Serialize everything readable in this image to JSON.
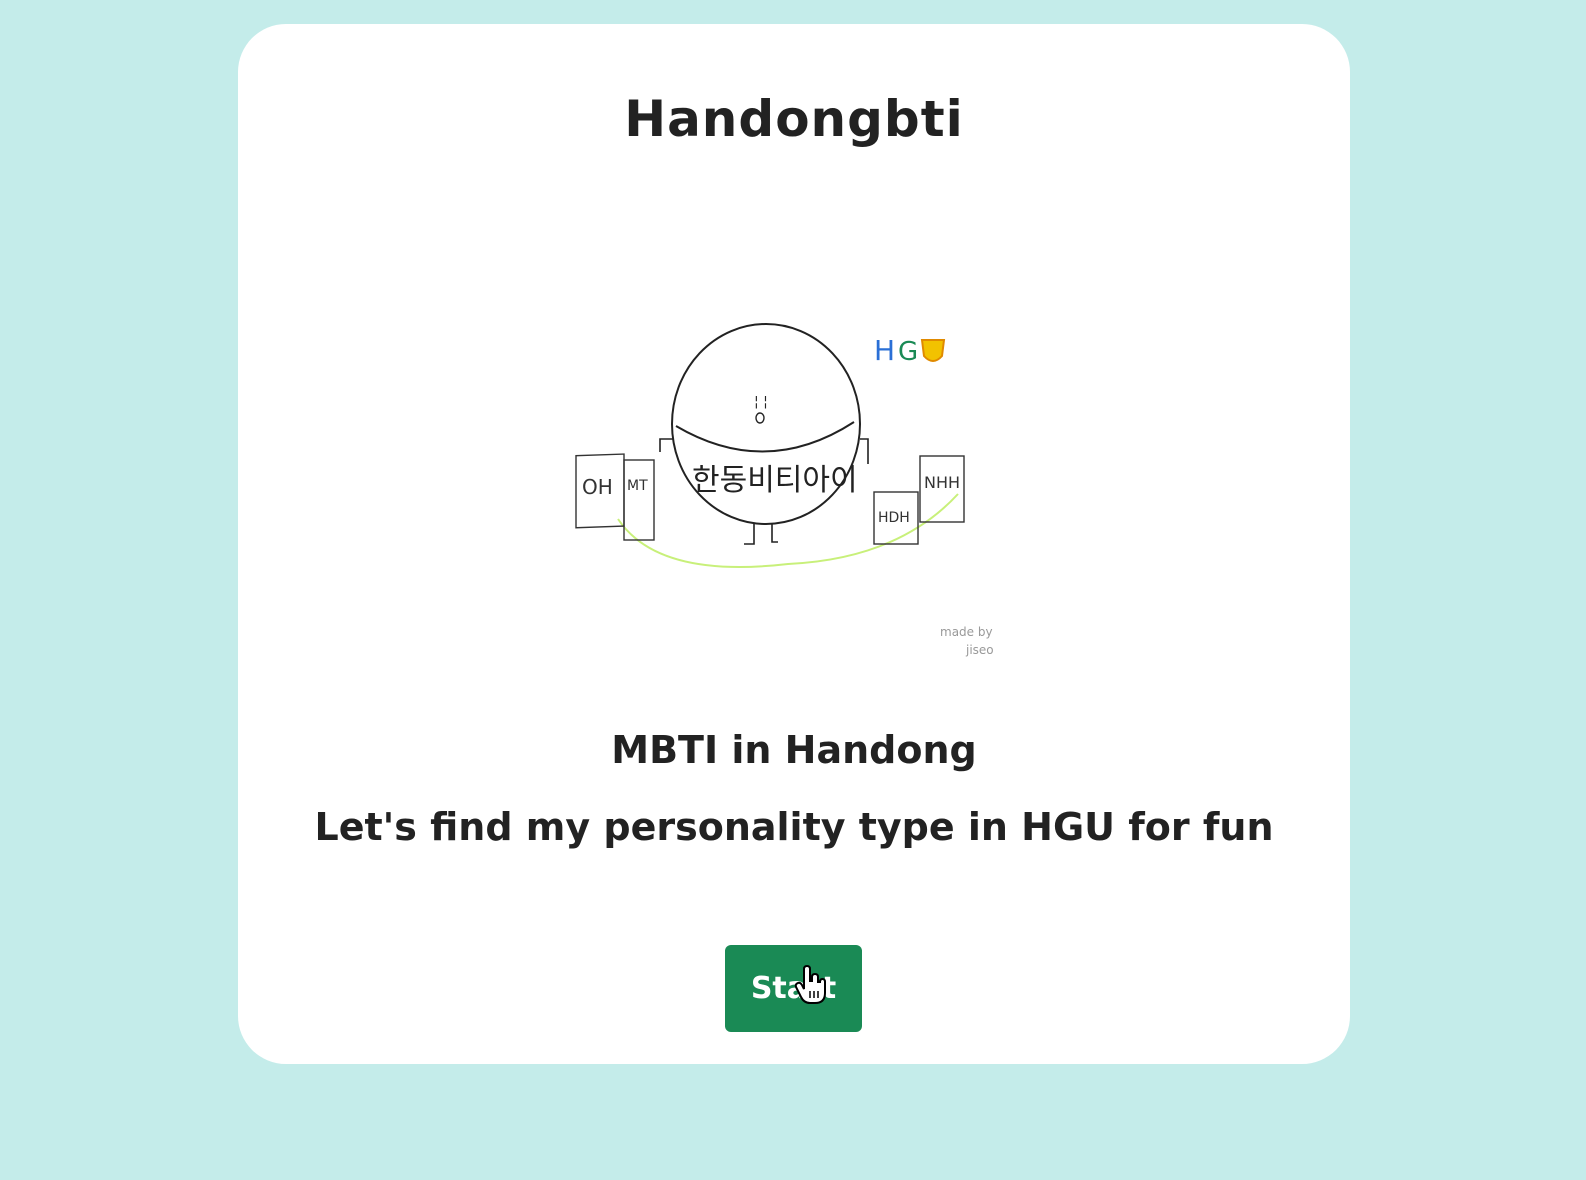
{
  "header": {
    "title": "Handongbti"
  },
  "illustration": {
    "character_label": "한동비티아이",
    "logo_text": "HG",
    "left_sign_text": "OH",
    "left_sign_side_text": "MT",
    "right_sign_text": "NHH",
    "right_small_sign_text": "HDH",
    "signature_line1": "made by",
    "signature_line2": "jiseo"
  },
  "main": {
    "subtitle": "MBTI in Handong",
    "description": "Let's find my personality type in HGU for fun",
    "start_label": "Start"
  },
  "colors": {
    "background": "#c4ecea",
    "card": "#ffffff",
    "button": "#1a8a55",
    "accent_green_line": "#c8f07a",
    "logo_blue": "#2a6fd6",
    "logo_green": "#1a8a55",
    "logo_shield": "#f2c200"
  }
}
